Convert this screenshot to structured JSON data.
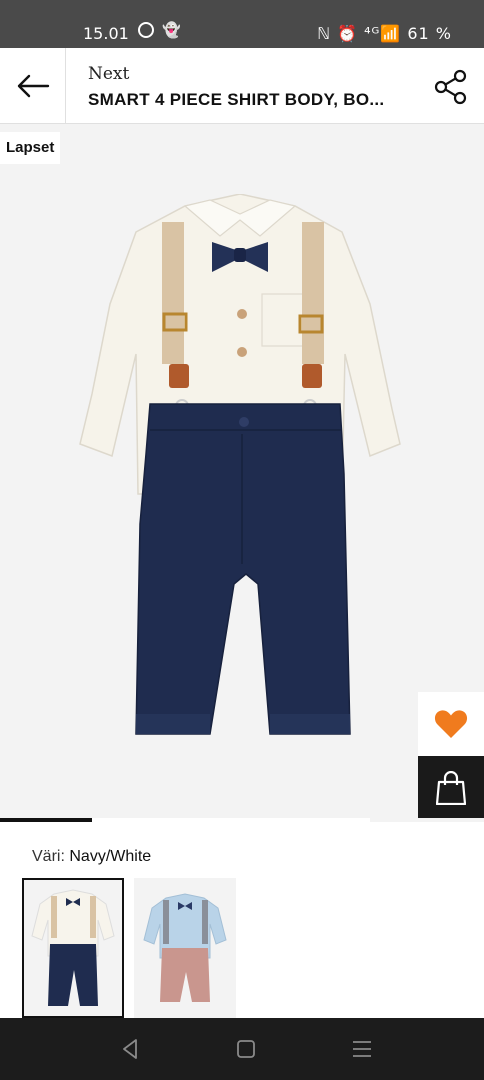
{
  "status": {
    "time": "15.01",
    "battery": "61 %",
    "signal": "ℕ ⏰ ⁴ᴳ📶"
  },
  "header": {
    "brand": "Next",
    "title": "SMART 4 PIECE SHIRT BODY, BO..."
  },
  "badge": "Lapset",
  "colors": {
    "accent": "#f07b1e",
    "dark": "#111111",
    "navy": "#1f2c4f"
  },
  "variants": {
    "color_label": "Väri:",
    "color_value": "Navy/White",
    "selected_index": 0,
    "count": 2
  },
  "gallery": {
    "progress_fraction": 0.25
  },
  "icons": [
    "back-arrow-icon",
    "share-icon",
    "heart-icon",
    "shopping-bag-icon",
    "nav-back-icon",
    "nav-home-icon",
    "nav-menu-icon"
  ]
}
